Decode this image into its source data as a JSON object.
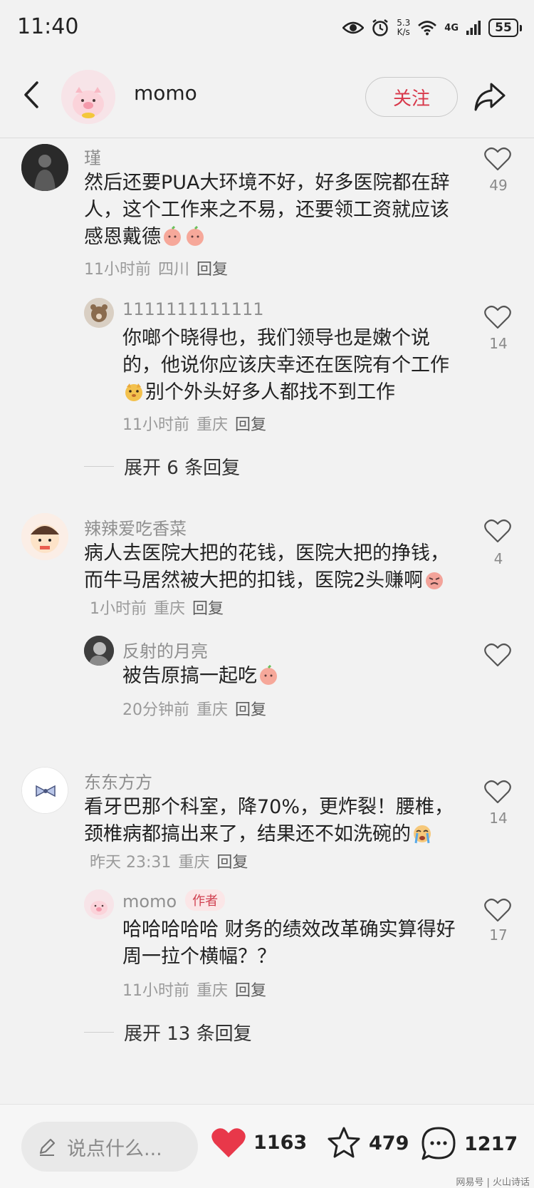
{
  "status_bar": {
    "time": "11:40",
    "net_speed_value": "5.3",
    "net_speed_unit": "K/s",
    "net_type": "4G",
    "battery": "55"
  },
  "header": {
    "name": "momo",
    "follow_label": "关注"
  },
  "comments": [
    {
      "name": "瑾",
      "text": "然后还要PUA大环境不好，好多医院都在辞人，这个工作来之不易，还要领工资就应该感恩戴德",
      "emoji_after": [
        "peach-emoji",
        "peach-emoji"
      ],
      "time": "11小时前",
      "location": "四川",
      "reply_label": "回复",
      "likes": "49",
      "replies": [
        {
          "name": "1111111111111",
          "text_before_emoji": "你啷个晓得也，我们领导也是嫩个说的，他说你应该庆幸还在医院有个工作",
          "text_after_emoji": "别个外头好多人都找不到工作",
          "emoji": "dog-emoji",
          "time": "11小时前",
          "location": "重庆",
          "reply_label": "回复",
          "likes": "14"
        }
      ],
      "expand_label": "展开 6 条回复"
    },
    {
      "name": "辣辣爱吃香菜",
      "text": "病人去医院大把的花钱，医院大把的挣钱，而牛马居然被大把的扣钱，医院2头赚啊",
      "emoji_after": [
        "angry-peach-emoji"
      ],
      "time": "1小时前",
      "location": "重庆",
      "reply_label": "回复",
      "likes": "4",
      "replies": [
        {
          "name": "反射的月亮",
          "text": "被告原搞一起吃",
          "emoji_after": [
            "peach-emoji"
          ],
          "time": "20分钟前",
          "location": "重庆",
          "reply_label": "回复",
          "likes": ""
        }
      ]
    },
    {
      "name": "东东方方",
      "text": "看牙巴那个科室，降70%，更炸裂！腰椎，颈椎病都搞出来了，结果还不如洗碗的",
      "emoji_after": [
        "crying-emoji"
      ],
      "time": "昨天 23:31",
      "location": "重庆",
      "reply_label": "回复",
      "likes": "14",
      "replies": [
        {
          "name": "momo",
          "badge": "作者",
          "text": "哈哈哈哈哈  财务的绩效改革确实算得好  周一拉个横幅？？",
          "time": "11小时前",
          "location": "重庆",
          "reply_label": "回复",
          "likes": "17"
        }
      ],
      "expand_label": "展开 13 条回复"
    }
  ],
  "bottom_bar": {
    "input_placeholder": "说点什么...",
    "like_count": "1163",
    "favorite_count": "479",
    "comment_count": "1217",
    "watermark": "网易号 | 火山诗话"
  },
  "colors": {
    "accent": "#d8394b",
    "heart": "#e8384a"
  }
}
